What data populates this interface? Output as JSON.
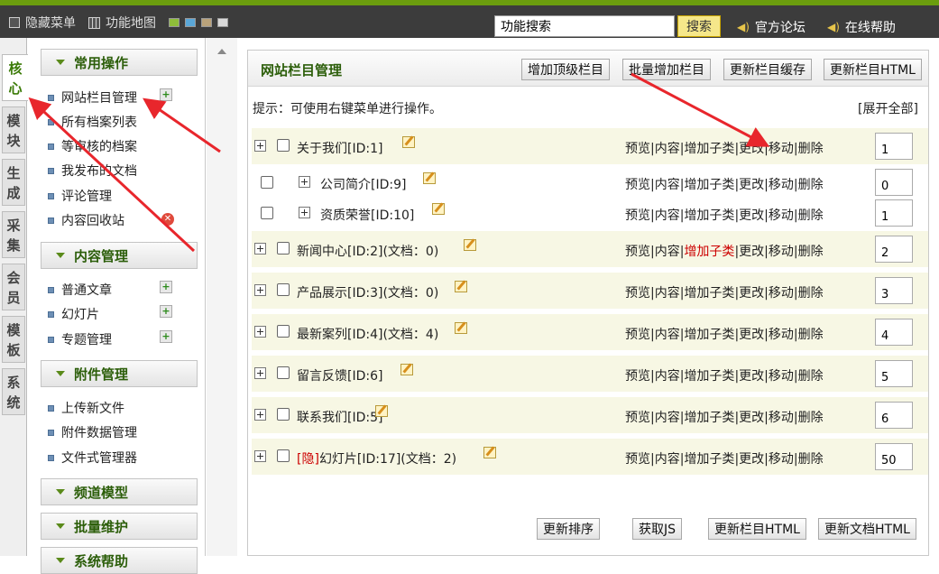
{
  "topbar": {
    "hide_menu": "隐藏菜单",
    "feature_map": "功能地图",
    "search_placeholder": "功能搜索",
    "search_button": "搜索",
    "forum": "官方论坛",
    "help": "在线帮助"
  },
  "left_tabs": [
    "核心",
    "模块",
    "生成",
    "采集",
    "会员",
    "模板",
    "系统"
  ],
  "sidebar": {
    "sections": {
      "common": "常用操作",
      "content": "内容管理",
      "attach": "附件管理",
      "channel": "频道模型",
      "batch": "批量维护",
      "help": "系统帮助"
    },
    "common_items": [
      "网站栏目管理",
      "所有档案列表",
      "等审核的档案",
      "我发布的文档",
      "评论管理",
      "内容回收站"
    ],
    "content_items": [
      "普通文章",
      "幻灯片",
      "专题管理"
    ],
    "attach_items": [
      "上传新文件",
      "附件数据管理",
      "文件式管理器"
    ]
  },
  "panel": {
    "title": "网站栏目管理",
    "buttons": [
      "增加顶级栏目",
      "批量增加栏目",
      "更新栏目缓存",
      "更新栏目HTML"
    ],
    "tip": "提示：可使用右键菜单进行操作。",
    "expand_all": "[展开全部]",
    "actions": {
      "preview": "预览",
      "content": "内容",
      "add_sub": "增加子类",
      "edit": "更改",
      "move": "移动",
      "delete": "删除",
      "sep": "|"
    },
    "rows": [
      {
        "name": "关于我们[ID:1]",
        "order": "1"
      },
      {
        "name": "公司简介[ID:9]",
        "order": "0"
      },
      {
        "name": "资质荣誉[ID:10]",
        "order": "1"
      },
      {
        "name": "新闻中心[ID:2](文档：0)",
        "order": "2"
      },
      {
        "name": "产品展示[ID:3](文档：0)",
        "order": "3"
      },
      {
        "name": "最新案列[ID:4](文档：4)",
        "order": "4"
      },
      {
        "name": "留言反馈[ID:6]",
        "order": "5"
      },
      {
        "name": "联系我们[ID:5]",
        "order": "6"
      },
      {
        "name": "幻灯片[ID:17](文档：2)",
        "hidden_tag": "[隐]",
        "order": "50"
      }
    ],
    "bottom_buttons": [
      "更新排序",
      "获取JS",
      "更新栏目HTML",
      "更新文档HTML"
    ]
  },
  "colors": {
    "accent": "#6b9d0e",
    "section_text": "#2c5e0a",
    "arrow": "#e8262c"
  }
}
